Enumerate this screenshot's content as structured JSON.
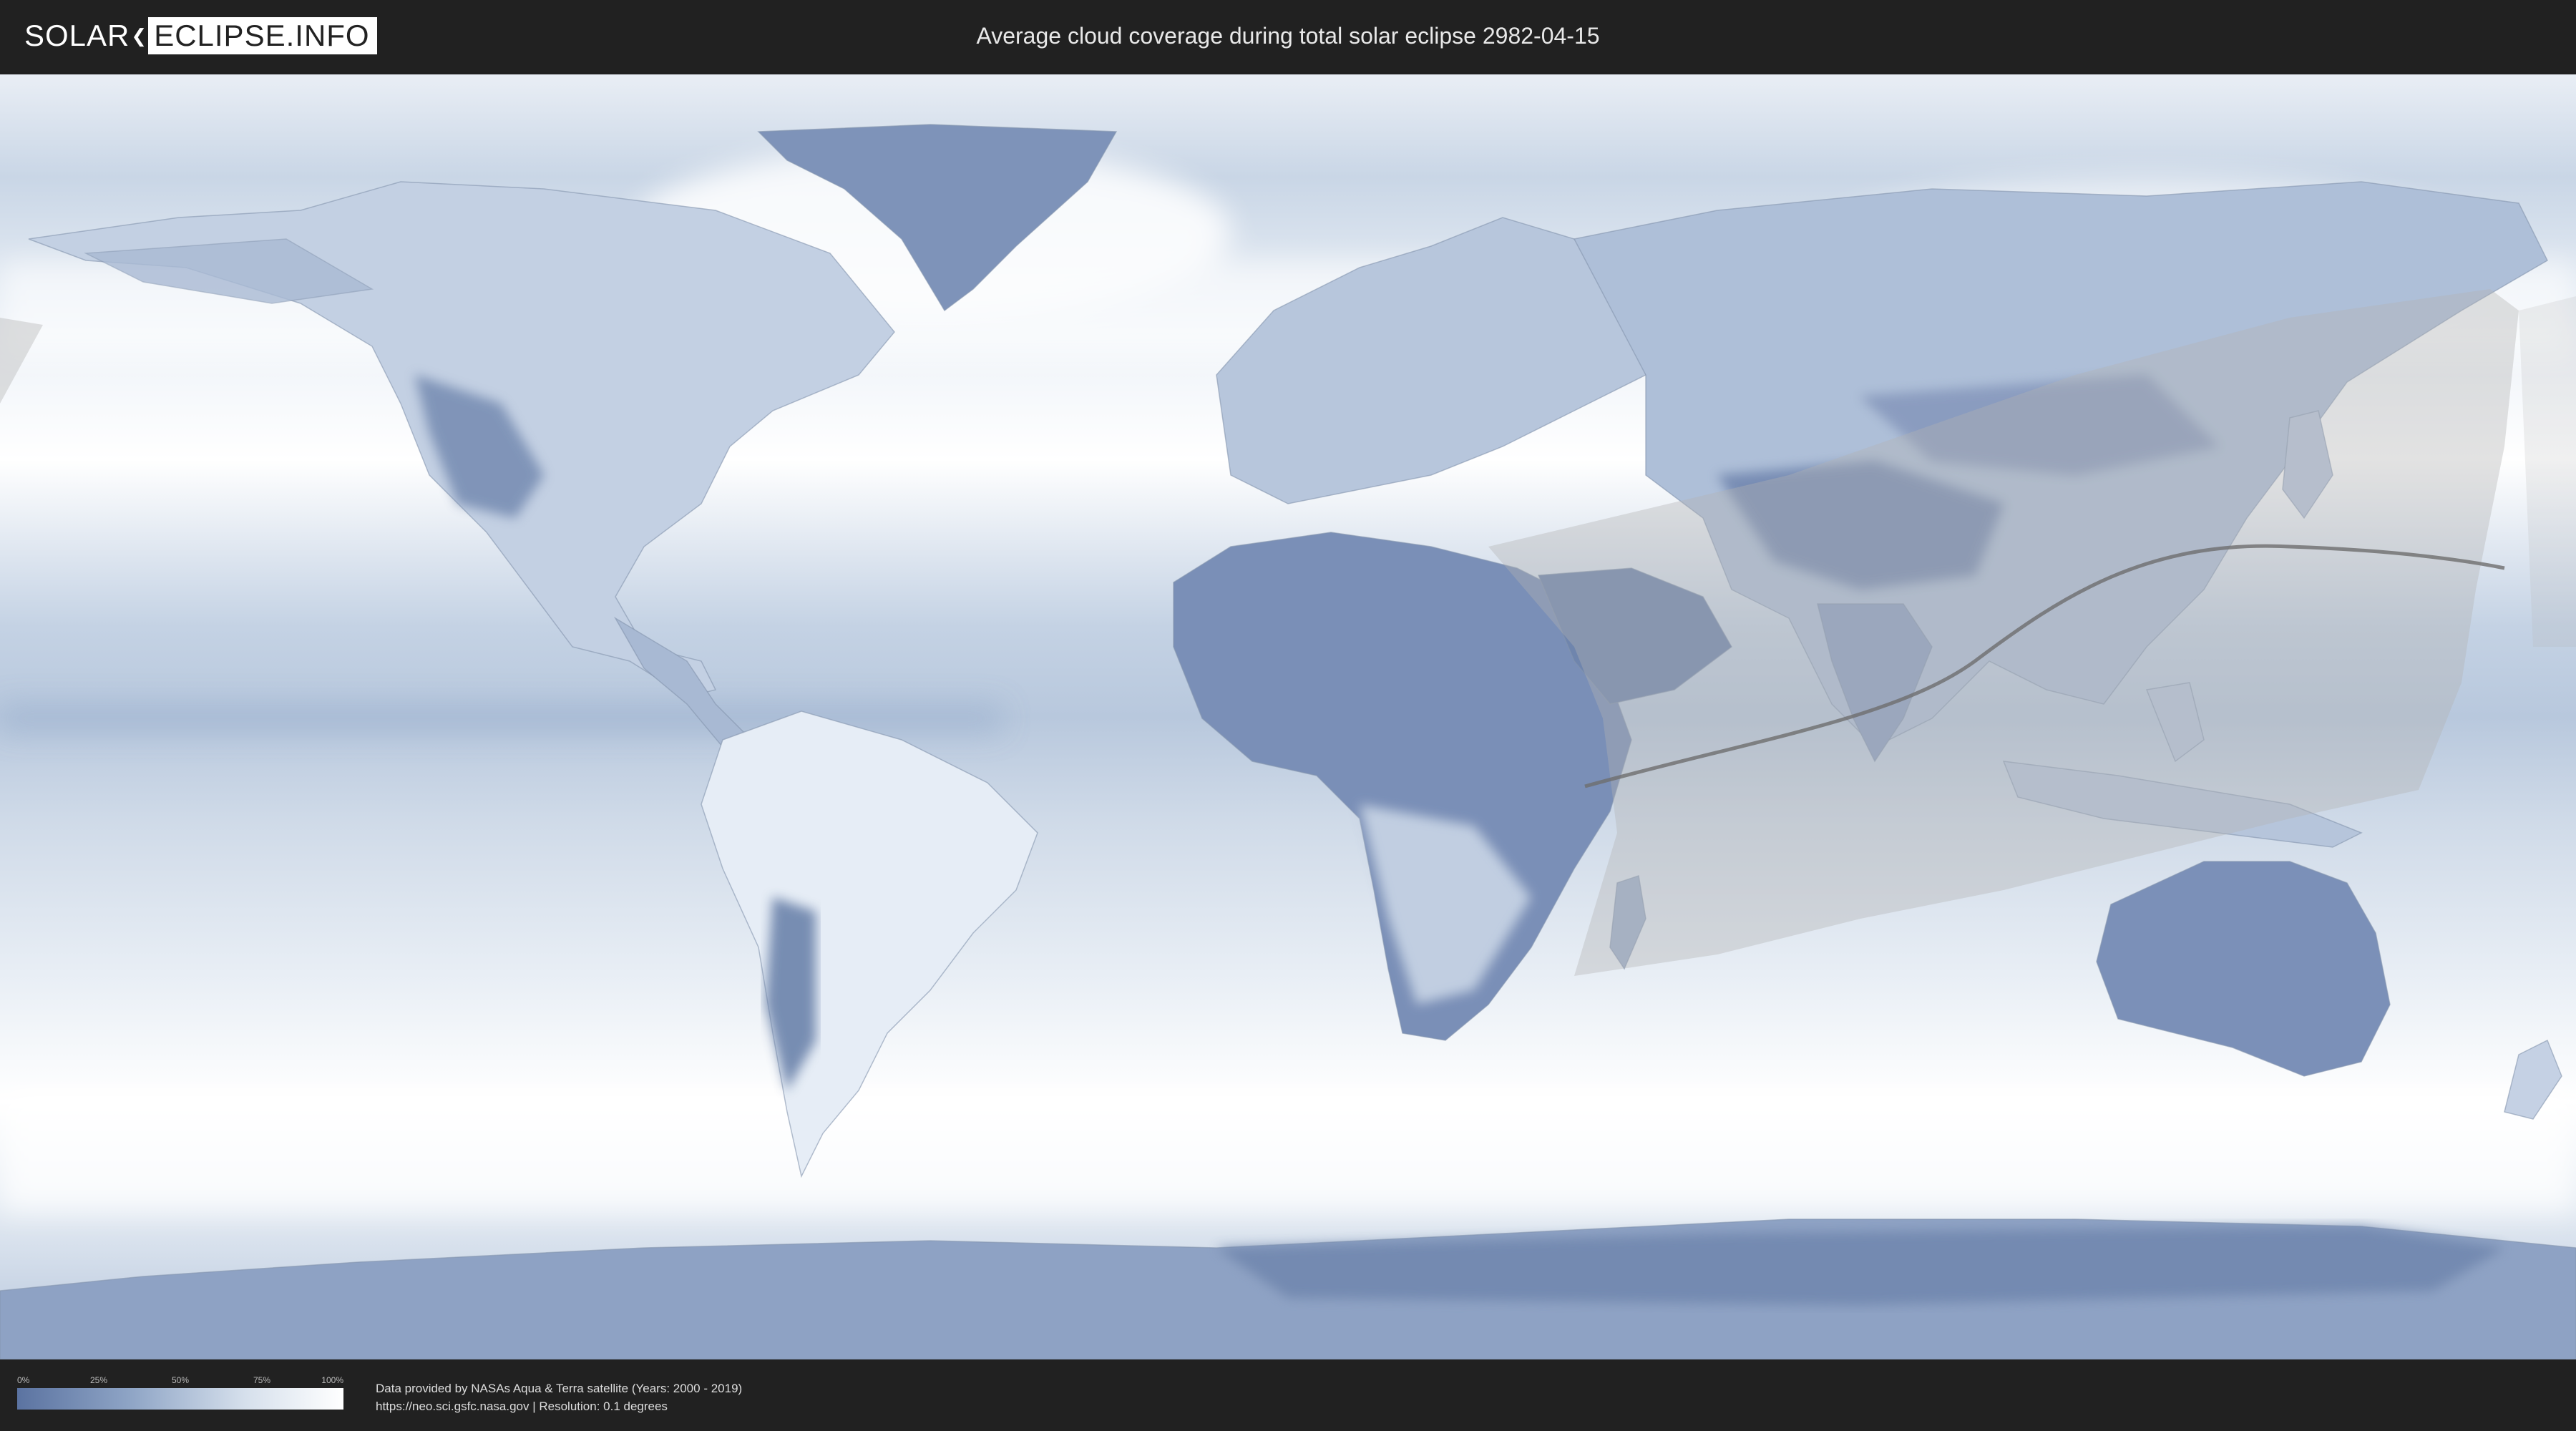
{
  "header": {
    "logo_part1": "SOLAR",
    "logo_separator": "❮",
    "logo_part2": "ECLIPSE.INFO",
    "title": "Average cloud coverage during total solar eclipse 2982-04-15"
  },
  "map": {
    "projection": "equirectangular",
    "layer": "average cloud coverage",
    "palette": {
      "ocean_clear": "#dfe7f1",
      "cloudy": "#ffffff",
      "clear_sky": "#5b73a1",
      "eclipse_visibility_zone": "#b4b4b4",
      "totality_path": "#6e6e6e",
      "frame": "#3a3a3a"
    },
    "eclipse_path_label": ""
  },
  "legend": {
    "ticks": [
      "0%",
      "25%",
      "50%",
      "75%",
      "100%"
    ],
    "gradient_from": "#5b73a1",
    "gradient_to": "#ffffff"
  },
  "footer": {
    "credit_line1": "Data provided by NASAs Aqua & Terra satellite (Years: 2000 - 2019)",
    "credit_line2": "https://neo.sci.gsfc.nasa.gov | Resolution: 0.1 degrees"
  }
}
